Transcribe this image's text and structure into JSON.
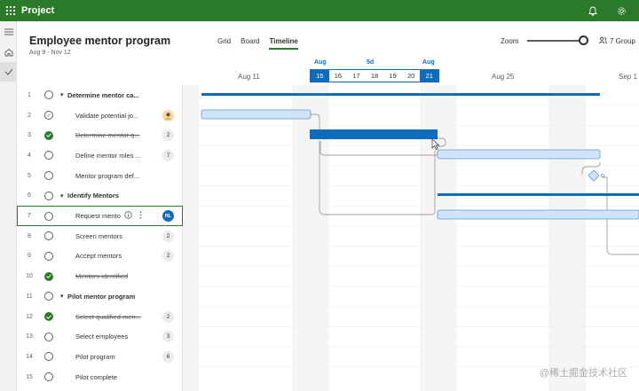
{
  "app": {
    "title": "Project"
  },
  "plan": {
    "title": "Employee mentor program",
    "dates": "Aug 9 - Nov 12"
  },
  "tabs": [
    {
      "label": "Grid",
      "active": false
    },
    {
      "label": "Board",
      "active": false
    },
    {
      "label": "Timeline",
      "active": true
    }
  ],
  "zoom": {
    "label": "Zoom",
    "level": 1.0
  },
  "group_button": {
    "label": "7 Group"
  },
  "timeline": {
    "weeks": [
      "Aug 11",
      "Aug 25",
      "Sep 1"
    ],
    "selection": {
      "start_month": "Aug",
      "end_month": "Aug",
      "span": "5d"
    },
    "days": [
      "15",
      "16",
      "17",
      "18",
      "19",
      "20",
      "21"
    ],
    "selected_days": [
      "15",
      "21"
    ]
  },
  "tasks": [
    {
      "num": "1",
      "name": "Determine mentor ca...",
      "type": "group",
      "status": "open"
    },
    {
      "num": "2",
      "name": "Validate potential jo...",
      "type": "task",
      "status": "hover",
      "assignee": "person"
    },
    {
      "num": "3",
      "name": "Determine mentor q...",
      "type": "task",
      "status": "done",
      "count": "2"
    },
    {
      "num": "4",
      "name": "Define mentor roles ...",
      "type": "task",
      "status": "open",
      "count": "7"
    },
    {
      "num": "5",
      "name": "Mentor program def...",
      "type": "task",
      "status": "open"
    },
    {
      "num": "6",
      "name": "Identify Mentors",
      "type": "group",
      "status": "open"
    },
    {
      "num": "7",
      "name": "Request mento",
      "type": "task",
      "status": "open",
      "selected": true,
      "assignee_initials": "RL"
    },
    {
      "num": "8",
      "name": "Screen mentors",
      "type": "task",
      "status": "open",
      "count": "2"
    },
    {
      "num": "9",
      "name": "Accept mentors",
      "type": "task",
      "status": "open",
      "count": "2"
    },
    {
      "num": "10",
      "name": "Mentors identified",
      "type": "task",
      "status": "done"
    },
    {
      "num": "11",
      "name": "Pilot mentor program",
      "type": "group",
      "status": "open"
    },
    {
      "num": "12",
      "name": "Select qualified men...",
      "type": "task",
      "status": "done",
      "count": "2"
    },
    {
      "num": "13",
      "name": "Select employees",
      "type": "task",
      "status": "open",
      "count": "3"
    },
    {
      "num": "14",
      "name": "Pilot program",
      "type": "task",
      "status": "open",
      "count": "6"
    },
    {
      "num": "15",
      "name": "Pilot complete",
      "type": "task",
      "status": "open"
    }
  ],
  "colors": {
    "brand": "#2b7a2b",
    "accent": "#0f6cbd",
    "bar_light": "#cfe4fa"
  },
  "icons": {
    "waffle": "waffle-icon",
    "bell": "bell-icon",
    "settings": "gear-icon",
    "menu": "hamburger-icon",
    "home": "home-icon",
    "check": "checkmark-icon"
  },
  "watermark": "@稀土掘金技术社区"
}
